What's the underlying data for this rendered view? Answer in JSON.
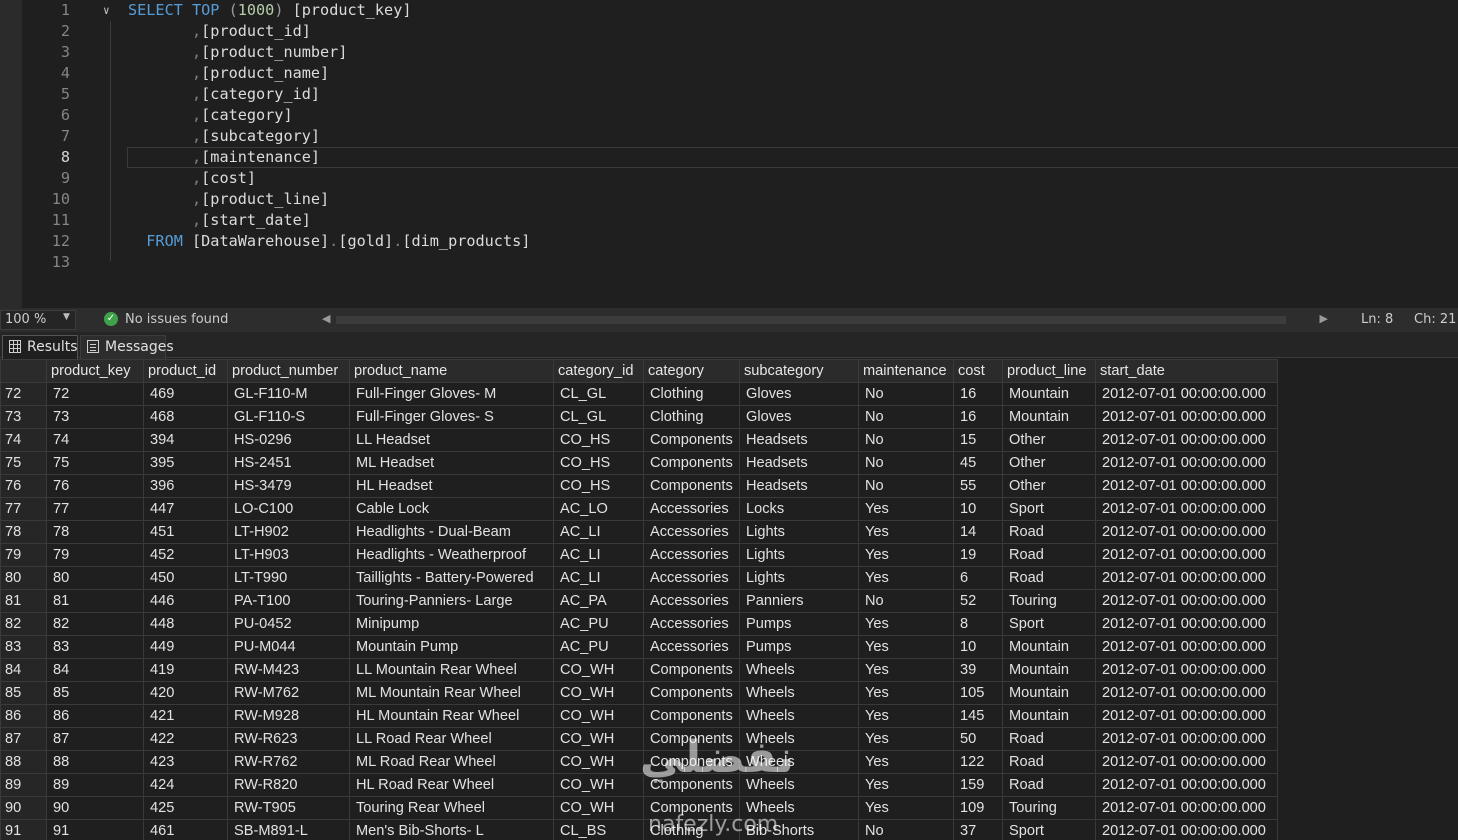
{
  "editor": {
    "lines": [
      {
        "n": "1",
        "parts": [
          {
            "t": "SELECT ",
            "c": "kw"
          },
          {
            "t": "TOP ",
            "c": "kw"
          },
          {
            "t": "(",
            "c": "gray"
          },
          {
            "t": "1000",
            "c": "num"
          },
          {
            "t": ") ",
            "c": "gray"
          },
          {
            "t": "[product_key]",
            "c": ""
          }
        ]
      },
      {
        "n": "2",
        "parts": [
          {
            "t": "       ,",
            "c": "punc"
          },
          {
            "t": "[product_id]",
            "c": ""
          }
        ]
      },
      {
        "n": "3",
        "parts": [
          {
            "t": "       ,",
            "c": "punc"
          },
          {
            "t": "[product_number]",
            "c": ""
          }
        ]
      },
      {
        "n": "4",
        "parts": [
          {
            "t": "       ,",
            "c": "punc"
          },
          {
            "t": "[product_name]",
            "c": ""
          }
        ]
      },
      {
        "n": "5",
        "parts": [
          {
            "t": "       ,",
            "c": "punc"
          },
          {
            "t": "[category_id]",
            "c": ""
          }
        ]
      },
      {
        "n": "6",
        "parts": [
          {
            "t": "       ,",
            "c": "punc"
          },
          {
            "t": "[category]",
            "c": ""
          }
        ]
      },
      {
        "n": "7",
        "parts": [
          {
            "t": "       ,",
            "c": "punc"
          },
          {
            "t": "[subcategory]",
            "c": ""
          }
        ]
      },
      {
        "n": "8",
        "parts": [
          {
            "t": "       ,",
            "c": "punc"
          },
          {
            "t": "[maintenance]",
            "c": ""
          }
        ]
      },
      {
        "n": "9",
        "parts": [
          {
            "t": "       ,",
            "c": "punc"
          },
          {
            "t": "[cost]",
            "c": ""
          }
        ]
      },
      {
        "n": "10",
        "parts": [
          {
            "t": "       ,",
            "c": "punc"
          },
          {
            "t": "[product_line]",
            "c": ""
          }
        ]
      },
      {
        "n": "11",
        "parts": [
          {
            "t": "       ,",
            "c": "punc"
          },
          {
            "t": "[start_date]",
            "c": ""
          }
        ]
      },
      {
        "n": "12",
        "parts": [
          {
            "t": "  FROM ",
            "c": "kw"
          },
          {
            "t": "[DataWarehouse]",
            "c": ""
          },
          {
            "t": ".",
            "c": "punc"
          },
          {
            "t": "[gold]",
            "c": ""
          },
          {
            "t": ".",
            "c": "punc"
          },
          {
            "t": "[dim_products]",
            "c": ""
          }
        ]
      },
      {
        "n": "13",
        "parts": []
      }
    ],
    "active_line": 8
  },
  "status": {
    "zoom": "100 %",
    "issues": "No issues found",
    "ln": "Ln: 8",
    "ch": "Ch: 21"
  },
  "tabs": {
    "results": "Results",
    "messages": "Messages"
  },
  "grid": {
    "columns": [
      "",
      "product_key",
      "product_id",
      "product_number",
      "product_name",
      "category_id",
      "category",
      "subcategory",
      "maintenance",
      "cost",
      "product_line",
      "start_date"
    ],
    "rows": [
      [
        "72",
        "72",
        "469",
        "GL-F110-M",
        "Full-Finger Gloves- M",
        "CL_GL",
        "Clothing",
        "Gloves",
        "No",
        "16",
        "Mountain",
        "2012-07-01 00:00:00.000"
      ],
      [
        "73",
        "73",
        "468",
        "GL-F110-S",
        "Full-Finger Gloves- S",
        "CL_GL",
        "Clothing",
        "Gloves",
        "No",
        "16",
        "Mountain",
        "2012-07-01 00:00:00.000"
      ],
      [
        "74",
        "74",
        "394",
        "HS-0296",
        "LL Headset",
        "CO_HS",
        "Components",
        "Headsets",
        "No",
        "15",
        "Other",
        "2012-07-01 00:00:00.000"
      ],
      [
        "75",
        "75",
        "395",
        "HS-2451",
        "ML Headset",
        "CO_HS",
        "Components",
        "Headsets",
        "No",
        "45",
        "Other",
        "2012-07-01 00:00:00.000"
      ],
      [
        "76",
        "76",
        "396",
        "HS-3479",
        "HL Headset",
        "CO_HS",
        "Components",
        "Headsets",
        "No",
        "55",
        "Other",
        "2012-07-01 00:00:00.000"
      ],
      [
        "77",
        "77",
        "447",
        "LO-C100",
        "Cable Lock",
        "AC_LO",
        "Accessories",
        "Locks",
        "Yes",
        "10",
        "Sport",
        "2012-07-01 00:00:00.000"
      ],
      [
        "78",
        "78",
        "451",
        "LT-H902",
        "Headlights - Dual-Beam",
        "AC_LI",
        "Accessories",
        "Lights",
        "Yes",
        "14",
        "Road",
        "2012-07-01 00:00:00.000"
      ],
      [
        "79",
        "79",
        "452",
        "LT-H903",
        "Headlights - Weatherproof",
        "AC_LI",
        "Accessories",
        "Lights",
        "Yes",
        "19",
        "Road",
        "2012-07-01 00:00:00.000"
      ],
      [
        "80",
        "80",
        "450",
        "LT-T990",
        "Taillights - Battery-Powered",
        "AC_LI",
        "Accessories",
        "Lights",
        "Yes",
        "6",
        "Road",
        "2012-07-01 00:00:00.000"
      ],
      [
        "81",
        "81",
        "446",
        "PA-T100",
        "Touring-Panniers- Large",
        "AC_PA",
        "Accessories",
        "Panniers",
        "No",
        "52",
        "Touring",
        "2012-07-01 00:00:00.000"
      ],
      [
        "82",
        "82",
        "448",
        "PU-0452",
        "Minipump",
        "AC_PU",
        "Accessories",
        "Pumps",
        "Yes",
        "8",
        "Sport",
        "2012-07-01 00:00:00.000"
      ],
      [
        "83",
        "83",
        "449",
        "PU-M044",
        "Mountain Pump",
        "AC_PU",
        "Accessories",
        "Pumps",
        "Yes",
        "10",
        "Mountain",
        "2012-07-01 00:00:00.000"
      ],
      [
        "84",
        "84",
        "419",
        "RW-M423",
        "LL Mountain Rear Wheel",
        "CO_WH",
        "Components",
        "Wheels",
        "Yes",
        "39",
        "Mountain",
        "2012-07-01 00:00:00.000"
      ],
      [
        "85",
        "85",
        "420",
        "RW-M762",
        "ML Mountain Rear Wheel",
        "CO_WH",
        "Components",
        "Wheels",
        "Yes",
        "105",
        "Mountain",
        "2012-07-01 00:00:00.000"
      ],
      [
        "86",
        "86",
        "421",
        "RW-M928",
        "HL Mountain Rear Wheel",
        "CO_WH",
        "Components",
        "Wheels",
        "Yes",
        "145",
        "Mountain",
        "2012-07-01 00:00:00.000"
      ],
      [
        "87",
        "87",
        "422",
        "RW-R623",
        "LL Road Rear Wheel",
        "CO_WH",
        "Components",
        "Wheels",
        "Yes",
        "50",
        "Road",
        "2012-07-01 00:00:00.000"
      ],
      [
        "88",
        "88",
        "423",
        "RW-R762",
        "ML Road Rear Wheel",
        "CO_WH",
        "Components",
        "Wheels",
        "Yes",
        "122",
        "Road",
        "2012-07-01 00:00:00.000"
      ],
      [
        "89",
        "89",
        "424",
        "RW-R820",
        "HL Road Rear Wheel",
        "CO_WH",
        "Components",
        "Wheels",
        "Yes",
        "159",
        "Road",
        "2012-07-01 00:00:00.000"
      ],
      [
        "90",
        "90",
        "425",
        "RW-T905",
        "Touring Rear Wheel",
        "CO_WH",
        "Components",
        "Wheels",
        "Yes",
        "109",
        "Touring",
        "2012-07-01 00:00:00.000"
      ],
      [
        "91",
        "91",
        "461",
        "SB-M891-L",
        "Men's Bib-Shorts- L",
        "CL_BS",
        "Clothing",
        "Bib-Shorts",
        "No",
        "37",
        "Sport",
        "2012-07-01 00:00:00.000"
      ]
    ]
  },
  "watermark": {
    "text": "نفضلي",
    "sub": "nafezly.com"
  }
}
